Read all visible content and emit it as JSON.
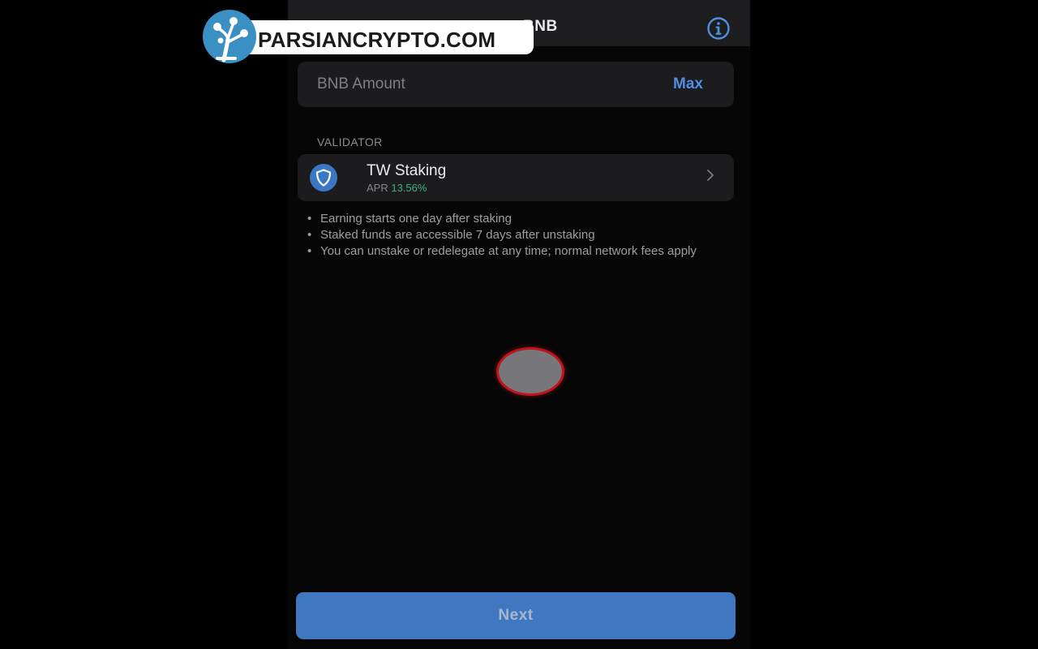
{
  "watermark": {
    "text": "PARSIANCRYPTO.COM",
    "icon": "tree-logo-icon",
    "color": "#3a8fc3"
  },
  "header": {
    "title": "BNB",
    "info_icon": "info-icon",
    "background": "#1d1d20"
  },
  "amount": {
    "placeholder": "BNB Amount",
    "value": "",
    "max_label": "Max",
    "accent": "#4f8fe0"
  },
  "validator": {
    "section_label": "VALIDATOR",
    "name": "TW Staking",
    "apr_label": "APR",
    "apr_value": "13.56%",
    "logo_icon": "shield-icon",
    "chevron_icon": "chevron-right-icon",
    "apr_color": "#3fae82"
  },
  "notes": [
    "Earning starts one day after staking",
    "Staked funds are accessible 7 days after unstaking",
    "You can unstake or redelegate at any time; normal network fees apply"
  ],
  "next_button": {
    "label": "Next",
    "color": "#3f78c0"
  },
  "touch_indicator": {
    "icon": "touch-indicator-icon",
    "ring_color": "#c0141b"
  }
}
